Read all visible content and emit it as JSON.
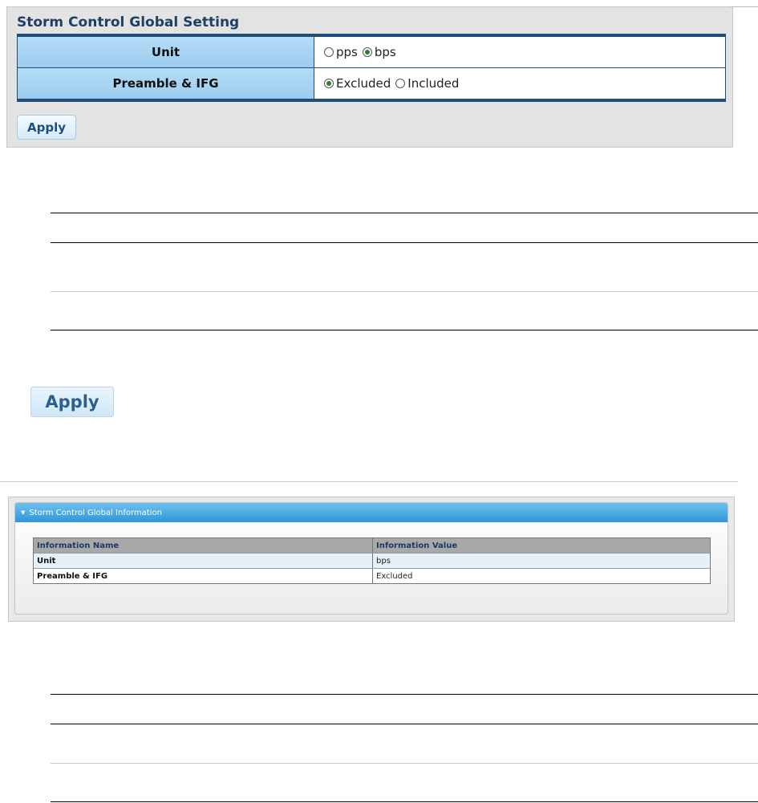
{
  "setting_panel": {
    "title": "Storm Control Global Setting",
    "rows": [
      {
        "label": "Unit",
        "options": [
          {
            "label": "pps",
            "checked": false
          },
          {
            "label": "bps",
            "checked": true
          }
        ]
      },
      {
        "label": "Preamble & IFG",
        "options": [
          {
            "label": "Excluded",
            "checked": true
          },
          {
            "label": "Included",
            "checked": false
          }
        ]
      }
    ],
    "apply_label": "Apply"
  },
  "apply_button": {
    "label": "Apply"
  },
  "info_panel": {
    "title": "Storm Control Global Information",
    "headers": [
      "Information Name",
      "Information Value"
    ],
    "rows": [
      {
        "name": "Unit",
        "value": "bps"
      },
      {
        "name": "Preamble & IFG",
        "value": "Excluded"
      }
    ]
  },
  "colors": {
    "title_text": "#1e3f66",
    "table_border": "#1f4e79",
    "label_cell": "#a8d4f3",
    "radio_checked": "#2e7d32",
    "info_header": "#2c96d8"
  },
  "icons": {
    "collapse": "caret-down-icon",
    "radio_on": "radio-checked-icon",
    "radio_off": "radio-unchecked-icon"
  }
}
